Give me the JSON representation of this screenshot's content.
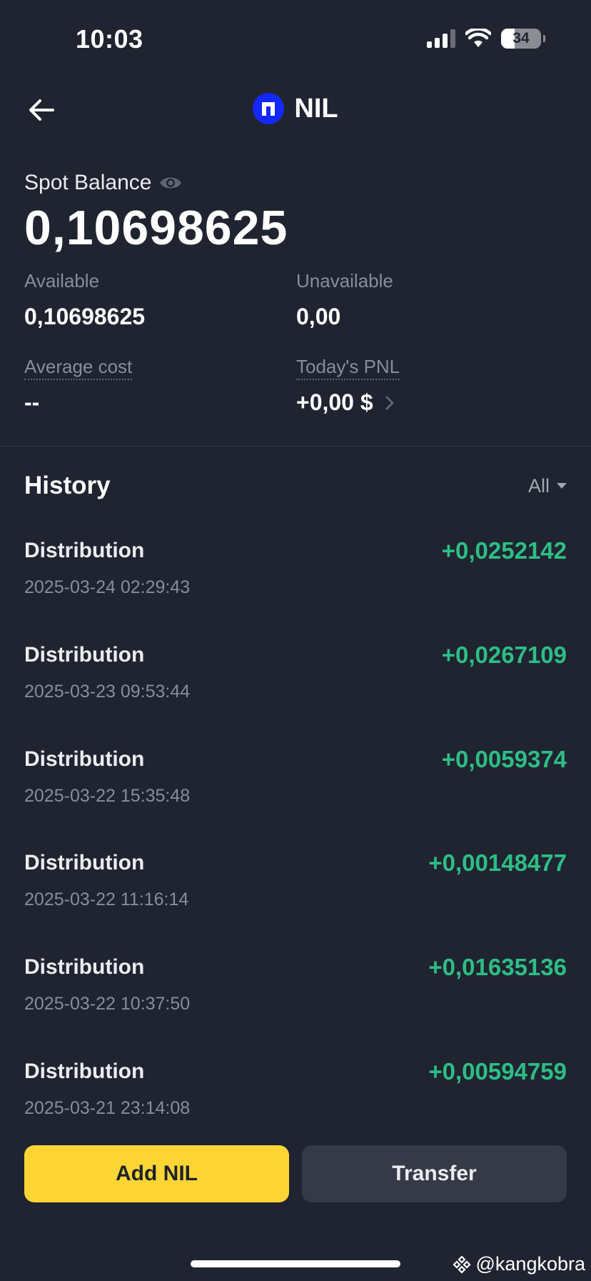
{
  "status_bar": {
    "time": "10:03",
    "battery": "34"
  },
  "header": {
    "title": "NIL"
  },
  "balance": {
    "label": "Spot Balance",
    "value": "0,10698625"
  },
  "details": {
    "available_label": "Available",
    "available_value": "0,10698625",
    "unavailable_label": "Unavailable",
    "unavailable_value": "0,00",
    "avg_cost_label": "Average cost",
    "avg_cost_value": "--",
    "pnl_label": "Today's PNL",
    "pnl_value": "+0,00 $"
  },
  "history": {
    "title": "History",
    "filter": "All",
    "items": [
      {
        "type": "Distribution",
        "time": "2025-03-24 02:29:43",
        "amount": "+0,0252142"
      },
      {
        "type": "Distribution",
        "time": "2025-03-23 09:53:44",
        "amount": "+0,0267109"
      },
      {
        "type": "Distribution",
        "time": "2025-03-22 15:35:48",
        "amount": "+0,0059374"
      },
      {
        "type": "Distribution",
        "time": "2025-03-22 11:16:14",
        "amount": "+0,00148477"
      },
      {
        "type": "Distribution",
        "time": "2025-03-22 10:37:50",
        "amount": "+0,01635136"
      },
      {
        "type": "Distribution",
        "time": "2025-03-21 23:14:08",
        "amount": "+0,00594759"
      }
    ]
  },
  "actions": {
    "add_label": "Add NIL",
    "transfer_label": "Transfer"
  },
  "watermark": "@kangkobra",
  "colors": {
    "background": "#1f2430",
    "accent_yellow": "#fcd535",
    "positive_green": "#2ebd85",
    "coin_blue": "#1228ff"
  },
  "icons": [
    "back-arrow-icon",
    "nil-coin-icon",
    "eye-icon",
    "chevron-right-icon",
    "caret-down-icon",
    "signal-icon",
    "wifi-icon",
    "battery-icon",
    "binance-logo-icon"
  ]
}
